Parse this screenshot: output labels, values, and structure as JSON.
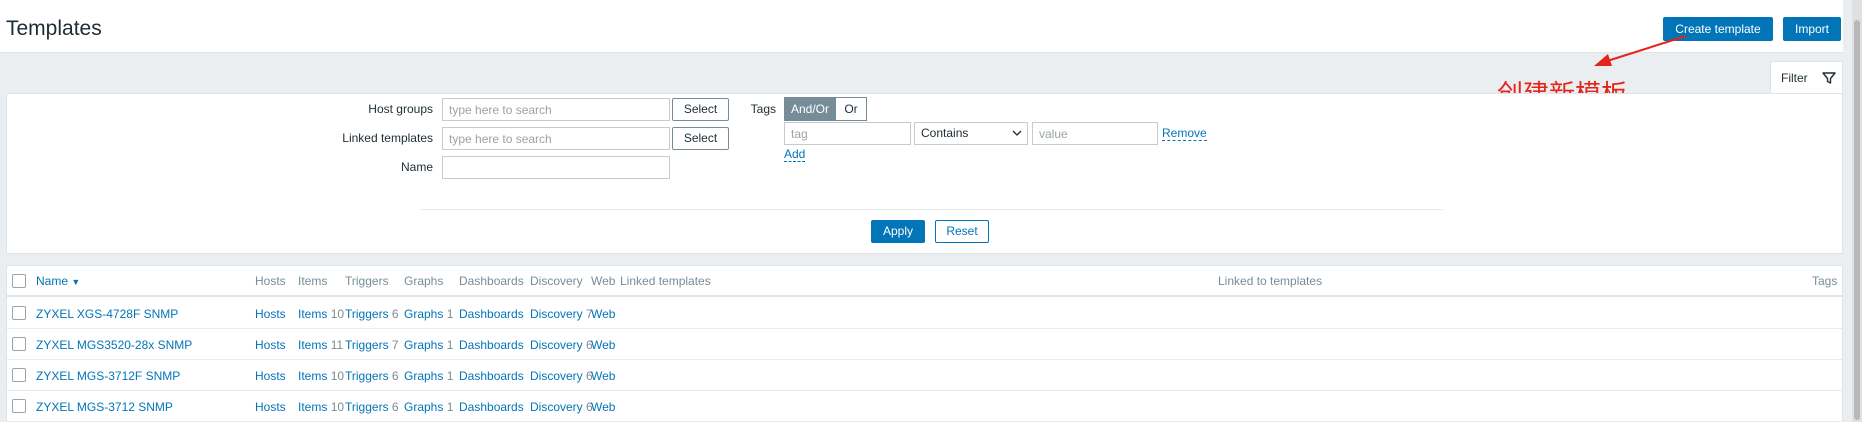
{
  "header": {
    "title": "Templates",
    "create_label": "Create template",
    "import_label": "Import"
  },
  "annotation": {
    "text": "创建新模板",
    "color": "#e4231b"
  },
  "filter": {
    "tab_label": "Filter",
    "host_groups_label": "Host groups",
    "host_groups_placeholder": "type here to search",
    "linked_templates_label": "Linked templates",
    "linked_templates_placeholder": "type here to search",
    "name_label": "Name",
    "name_value": "",
    "select_label": "Select",
    "tags_label": "Tags",
    "tag_mode_and_or": "And/Or",
    "tag_mode_or": "Or",
    "tag_placeholder": "tag",
    "tag_operator": "Contains",
    "value_placeholder": "value",
    "remove_label": "Remove",
    "add_label": "Add",
    "apply_label": "Apply",
    "reset_label": "Reset"
  },
  "table": {
    "headers": {
      "name": "Name",
      "hosts": "Hosts",
      "items": "Items",
      "triggers": "Triggers",
      "graphs": "Graphs",
      "dashboards": "Dashboards",
      "discovery": "Discovery",
      "web": "Web",
      "linked_templates": "Linked templates",
      "linked_to_templates": "Linked to templates",
      "tags": "Tags"
    },
    "sort_indicator": "▼",
    "rows": [
      {
        "name": "ZYXEL XGS-4728F SNMP",
        "hosts": "Hosts",
        "items": "Items",
        "items_count": "10",
        "triggers": "Triggers",
        "triggers_count": "6",
        "graphs": "Graphs",
        "graphs_count": "1",
        "dashboards": "Dashboards",
        "discovery": "Discovery",
        "discovery_count": "7",
        "web": "Web"
      },
      {
        "name": "ZYXEL MGS3520-28x SNMP",
        "hosts": "Hosts",
        "items": "Items",
        "items_count": "11",
        "triggers": "Triggers",
        "triggers_count": "7",
        "graphs": "Graphs",
        "graphs_count": "1",
        "dashboards": "Dashboards",
        "discovery": "Discovery",
        "discovery_count": "6",
        "web": "Web"
      },
      {
        "name": "ZYXEL MGS-3712F SNMP",
        "hosts": "Hosts",
        "items": "Items",
        "items_count": "10",
        "triggers": "Triggers",
        "triggers_count": "6",
        "graphs": "Graphs",
        "graphs_count": "1",
        "dashboards": "Dashboards",
        "discovery": "Discovery",
        "discovery_count": "6",
        "web": "Web"
      },
      {
        "name": "ZYXEL MGS-3712 SNMP",
        "hosts": "Hosts",
        "items": "Items",
        "items_count": "10",
        "triggers": "Triggers",
        "triggers_count": "6",
        "graphs": "Graphs",
        "graphs_count": "1",
        "dashboards": "Dashboards",
        "discovery": "Discovery",
        "discovery_count": "6",
        "web": "Web"
      }
    ]
  }
}
